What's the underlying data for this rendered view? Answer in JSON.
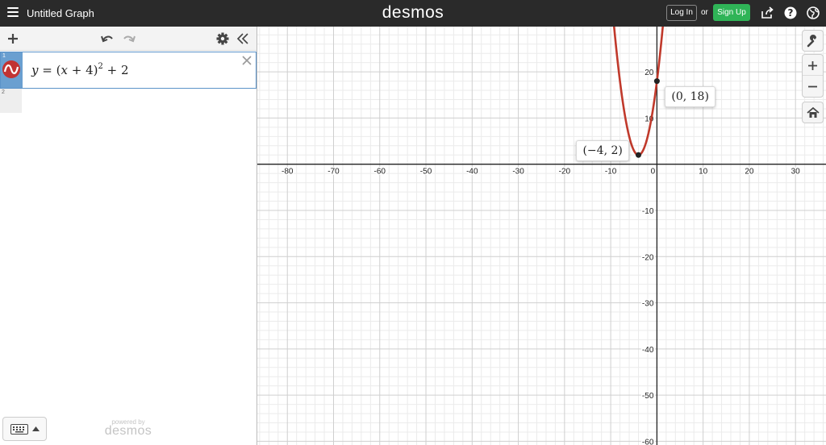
{
  "header": {
    "title": "Untitled Graph",
    "brand": "desmos",
    "login_label": "Log In",
    "or_label": "or",
    "signup_label": "Sign Up",
    "icons": [
      "menu-icon",
      "share-icon",
      "help-icon",
      "language-icon"
    ]
  },
  "toolbar": {
    "icons": [
      "add-icon",
      "undo-icon",
      "redo-icon",
      "settings-icon",
      "collapse-icon"
    ]
  },
  "expressions": [
    {
      "number": "1",
      "formula": {
        "lhs": "y",
        "eq": "=",
        "open": "(",
        "var": "x",
        "plus1": "+",
        "const1": "4",
        "close": ")",
        "exp": "2",
        "plus2": "+",
        "const2": "2"
      },
      "color": "#c23333"
    },
    {
      "number": "2"
    }
  ],
  "footer": {
    "powered_by": "powered by",
    "brand": "desmos"
  },
  "chart_data": {
    "type": "line",
    "x_ticks": [
      "-80",
      "-70",
      "-60",
      "-50",
      "-40",
      "-30",
      "-20",
      "-10",
      "0",
      "10",
      "20",
      "30"
    ],
    "y_ticks": [
      "20",
      "10",
      "-10",
      "-20",
      "-30",
      "-40",
      "-50",
      "-60"
    ],
    "xlim": [
      -86.5,
      36.6
    ],
    "ylim": [
      -60.8,
      29.8
    ],
    "grid": true,
    "series": [
      {
        "expression": "y=(x+4)^2+2",
        "color": "#c0392b"
      }
    ],
    "points": [
      {
        "x": -4,
        "y": 2,
        "label": "(−4, 2)"
      },
      {
        "x": 0,
        "y": 18,
        "label": "(0, 18)"
      }
    ]
  }
}
